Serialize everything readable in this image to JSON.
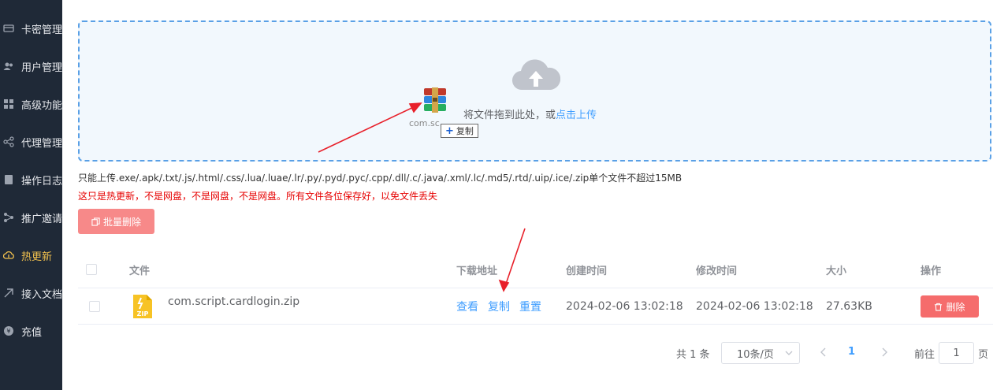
{
  "sidebar": {
    "items": [
      {
        "label": "卡密管理",
        "icon": "card-icon",
        "active": false
      },
      {
        "label": "用户管理",
        "icon": "user-icon",
        "active": false
      },
      {
        "label": "高级功能",
        "icon": "grid-icon",
        "active": false
      },
      {
        "label": "代理管理",
        "icon": "share-icon",
        "active": false
      },
      {
        "label": "操作日志",
        "icon": "log-icon",
        "active": false
      },
      {
        "label": "推广邀请",
        "icon": "network-icon",
        "active": false
      },
      {
        "label": "热更新",
        "icon": "cloud-icon",
        "active": true
      },
      {
        "label": "接入文档",
        "icon": "link-icon",
        "active": false
      },
      {
        "label": "充值",
        "icon": "coin-icon",
        "active": false
      }
    ]
  },
  "upload": {
    "text": "将文件拖到此处，或",
    "link": "点击上传",
    "drag_file_name": "com.sc...",
    "drag_tooltip": "复制"
  },
  "tips": {
    "allowed": "只能上传.exe/.apk/.txt/.js/.html/.css/.lua/.luae/.lr/.py/.pyd/.pyc/.cpp/.dll/.c/.java/.xml/.lc/.md5/.rtd/.uip/.ice/.zip单个文件不超过15MB",
    "warning": "这只是热更新，不是网盘，不是网盘，不是网盘。所有文件各位保存好，以免文件丢失"
  },
  "toolbar": {
    "batch_delete": "批量删除"
  },
  "table": {
    "headers": {
      "file": "文件",
      "download": "下载地址",
      "created": "创建时间",
      "modified": "修改时间",
      "size": "大小",
      "actions": "操作"
    },
    "rows": [
      {
        "file_name": "com.script.cardlogin.zip",
        "file_icon_label": "ZIP",
        "view": "查看",
        "copy": "复制",
        "reset": "重置",
        "created": "2024-02-06 13:02:18",
        "modified": "2024-02-06 13:02:18",
        "size": "27.63KB",
        "delete": "删除"
      }
    ]
  },
  "pagination": {
    "total": "共 1 条",
    "page_size": "10条/页",
    "current_page": "1",
    "goto_label": "前往",
    "goto_value": "1",
    "page_unit": "页"
  },
  "colors": {
    "sidebar_bg": "#1f2937",
    "active_text": "#f2c14e",
    "accent": "#409eff",
    "danger": "#f56c6c",
    "annotation_arrow": "#e8202a"
  }
}
